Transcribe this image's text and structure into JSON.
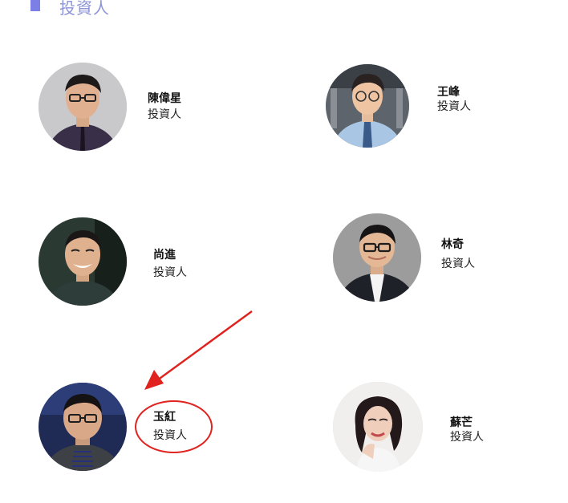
{
  "section": {
    "title": "投資人"
  },
  "investors": [
    {
      "name": "陳偉星",
      "role": "投資人",
      "photo_icon": "portrait-man-glasses-dark-shirt"
    },
    {
      "name": "王峰",
      "role": "投資人",
      "photo_icon": "portrait-man-glasses-blue-shirt"
    },
    {
      "name": "尚進",
      "role": "投資人",
      "photo_icon": "portrait-man-smiling"
    },
    {
      "name": "林奇",
      "role": "投資人",
      "photo_icon": "portrait-man-glasses-suit"
    },
    {
      "name": "玉紅",
      "role": "投資人",
      "photo_icon": "portrait-man-glasses-striped"
    },
    {
      "name": "蘇芒",
      "role": "投資人",
      "photo_icon": "portrait-woman"
    }
  ],
  "annotation": {
    "color": "#e0231f"
  },
  "colors": {
    "accent": "#7b7fe6",
    "title": "#8c93d8"
  }
}
